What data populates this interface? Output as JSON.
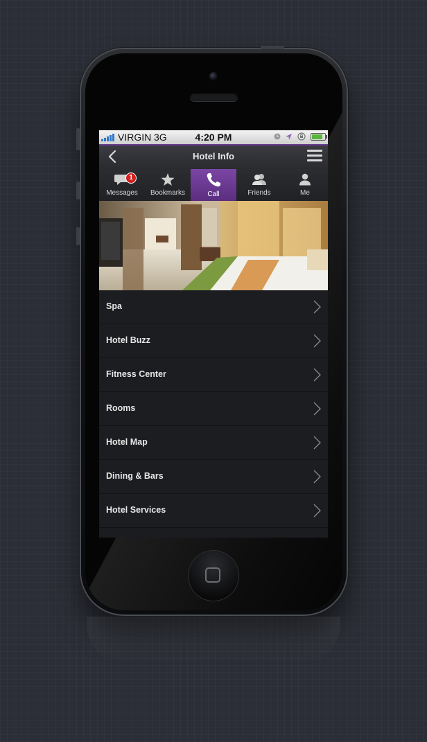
{
  "status_bar": {
    "carrier": "VIRGIN",
    "network": "3G",
    "time": "4:20 PM"
  },
  "nav": {
    "title": "Hotel Info",
    "back_icon": "chevron-left-icon",
    "menu_icon": "hamburger-icon"
  },
  "tabs": [
    {
      "label": "Messages",
      "icon": "chat-bubble-icon",
      "badge": "1",
      "active": false
    },
    {
      "label": "Bookmarks",
      "icon": "star-icon",
      "active": false
    },
    {
      "label": "Call",
      "icon": "phone-icon",
      "active": true
    },
    {
      "label": "Friends",
      "icon": "people-icon",
      "active": false
    },
    {
      "label": "Me",
      "icon": "person-icon",
      "active": false
    }
  ],
  "menu": [
    {
      "label": "Spa"
    },
    {
      "label": "Hotel Buzz"
    },
    {
      "label": "Fitness Center"
    },
    {
      "label": "Rooms"
    },
    {
      "label": "Hotel Map"
    },
    {
      "label": "Dining & Bars"
    },
    {
      "label": "Hotel Services"
    }
  ],
  "colors": {
    "accent": "#6a3b92",
    "badge": "#d41f1f",
    "background": "#2b2e36"
  }
}
